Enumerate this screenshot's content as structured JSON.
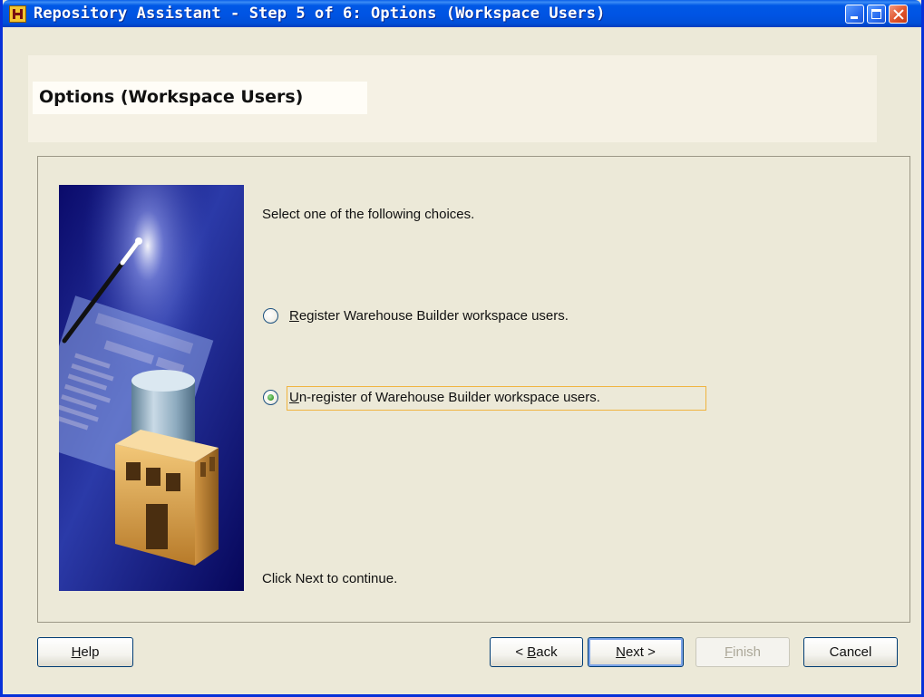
{
  "window": {
    "title": "Repository Assistant - Step 5 of 6: Options (Workspace Users)"
  },
  "header": {
    "title": "Options (Workspace Users)"
  },
  "content": {
    "instruction": "Select one of the following choices.",
    "options": [
      {
        "label": "Register Warehouse Builder workspace users.",
        "mnemonic": "R",
        "rest": "egister Warehouse Builder workspace users.",
        "selected": false
      },
      {
        "label": "Un-register of Warehouse Builder workspace users.",
        "mnemonic": "U",
        "rest": "n-register of Warehouse Builder workspace users.",
        "selected": true
      }
    ],
    "footer_hint": "Click Next to continue."
  },
  "buttons": {
    "help": {
      "mnemonic": "H",
      "rest": "elp"
    },
    "back": {
      "prefix": "< ",
      "mnemonic": "B",
      "rest": "ack"
    },
    "next": {
      "mnemonic": "N",
      "rest": "ext >"
    },
    "finish": {
      "mnemonic": "F",
      "rest": "inish",
      "enabled": false
    },
    "cancel": {
      "label": "Cancel"
    }
  },
  "colors": {
    "titlebar": "#0054e3",
    "dialog_bg": "#ece9d8",
    "focus": "#f0b440"
  },
  "icons": {
    "app": "repository-assistant-icon",
    "minimize": "minimize-icon",
    "maximize": "maximize-icon",
    "close": "close-icon",
    "illustration": "warehouse-wizard-illustration"
  }
}
